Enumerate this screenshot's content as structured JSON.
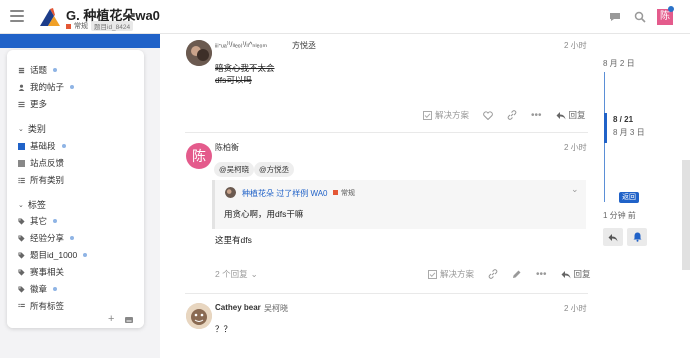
{
  "header": {
    "title": "G. 种植花朵wa0",
    "category": "常规",
    "tag": "题目id_8424",
    "user_initial": "陈"
  },
  "sidebar": {
    "items_top": [
      {
        "label": "话题",
        "icon": "topics-icon"
      },
      {
        "label": "我的帖子",
        "icon": "user-icon"
      },
      {
        "label": "更多",
        "icon": "more-icon"
      }
    ],
    "categories_heading": "类别",
    "categories": [
      {
        "label": "基础段",
        "color": "#2062c8"
      },
      {
        "label": "站点反馈",
        "color": "#888888"
      },
      {
        "label": "所有类别",
        "color": ""
      }
    ],
    "tags_heading": "标签",
    "tags": [
      {
        "label": "其它"
      },
      {
        "label": "经验分享"
      },
      {
        "label": "题目id_1000"
      },
      {
        "label": "赛事相关"
      },
      {
        "label": "徽章"
      },
      {
        "label": "所有标签"
      }
    ]
  },
  "posts": [
    {
      "username": "方悦丞",
      "username_prefix": "ᵢᵢᵢ-ᵤₐ⁾⁾/ₗₗₑₒ₎⁾/ₗₗ^ₙₗₑ₀ₘ",
      "time": "2 小时",
      "lines": [
        "暗贪心我不太会",
        "dfs可以吗"
      ],
      "solution": "解决方案",
      "reply": "回复"
    },
    {
      "username": "陈柏衡",
      "avatar_initial": "陈",
      "time": "2 小时",
      "mentions": [
        "@吴柯晓",
        "@方悦丞"
      ],
      "quote_author": "种植花朵 过了样例 WA0",
      "quote_category": "常规",
      "quote_text": "用贪心啊，用dfs干嘛",
      "text": "这里有dfs",
      "replies": "2 个回复",
      "solution": "解决方案",
      "reply": "回复"
    },
    {
      "username": "Cathey bear",
      "name": "吴柯晓",
      "time": "2 小时",
      "text": "？？"
    }
  ],
  "timeline": {
    "top_date": "8 月 2 日",
    "position": "8 / 21",
    "current_date": "8 月 3 日",
    "back": "返回",
    "bottom": "1 分钟 前"
  },
  "colors": {
    "accent": "#2062c8",
    "category": "#e45735",
    "avatar": "#e45b8c"
  }
}
